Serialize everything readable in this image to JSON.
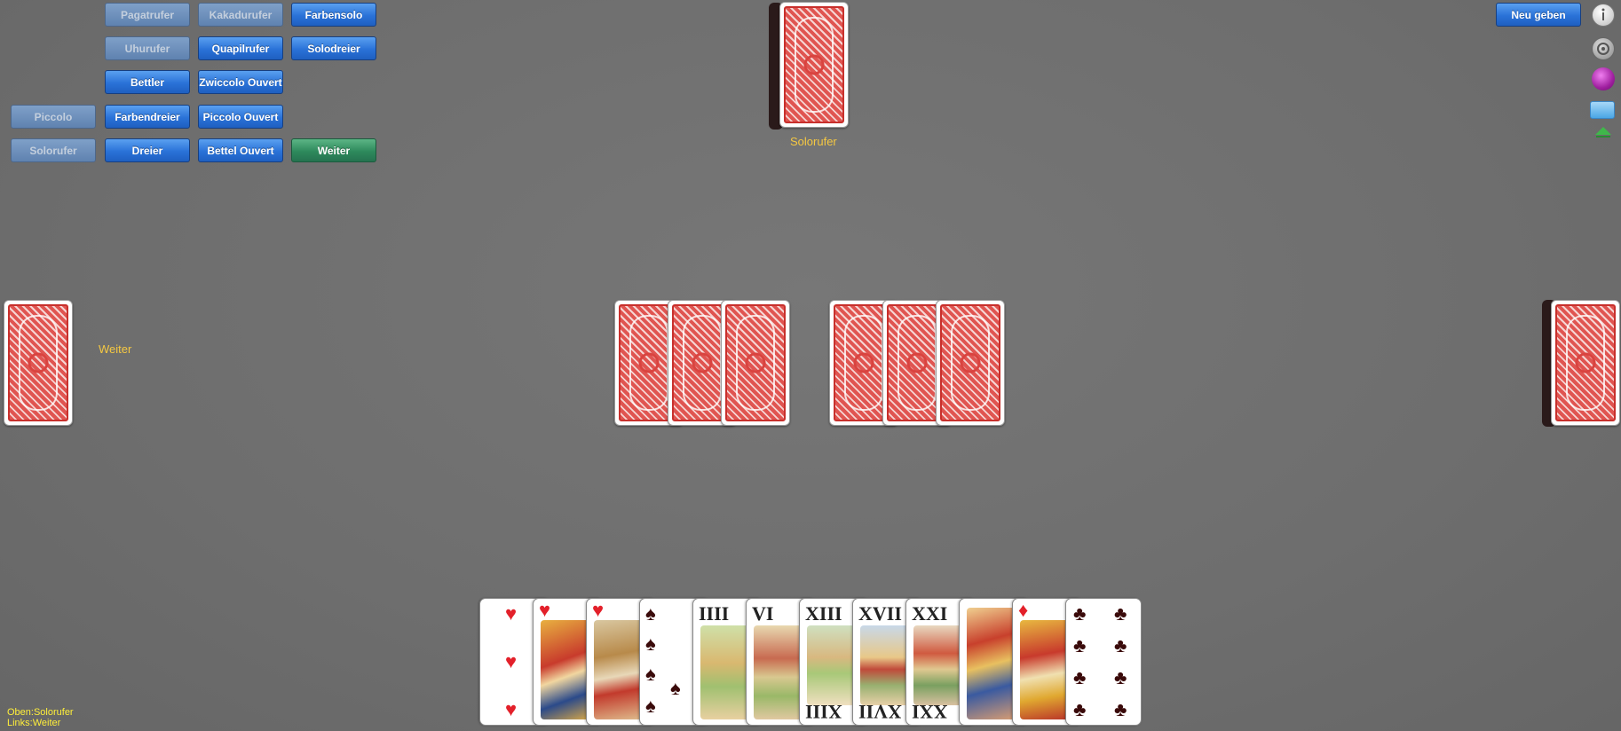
{
  "bids": {
    "pagatrufer": "Pagatrufer",
    "kakadurufer": "Kakadurufer",
    "farbensolo": "Farbensolo",
    "uhrufer": "Uhurufer",
    "quapilrufer": "Quapilrufer",
    "solodreier": "Solodreier",
    "bettler": "Bettler",
    "zwiccolo_ouvert": "Zwiccolo Ouvert",
    "piccolo": "Piccolo",
    "farbendreier": "Farbendreier",
    "piccolo_ouvert": "Piccolo Ouvert",
    "solorufer": "Solorufer",
    "dreier": "Dreier",
    "bettel_ouvert": "Bettel Ouvert",
    "weiter": "Weiter"
  },
  "new_deal_label": "Neu geben",
  "top_player_bid": "Solorufer",
  "left_player_bid": "Weiter",
  "hand": [
    {
      "type": "pip",
      "suit": "hearts",
      "rank": "pip-card"
    },
    {
      "type": "face",
      "suit": "hearts",
      "rank": "face-card"
    },
    {
      "type": "face",
      "suit": "hearts",
      "rank": "face-card"
    },
    {
      "type": "pip",
      "suit": "spades",
      "rank": "pip-card"
    },
    {
      "type": "tarock",
      "numeral": "IIII"
    },
    {
      "type": "tarock",
      "numeral": "VI"
    },
    {
      "type": "tarock",
      "numeral": "XIII"
    },
    {
      "type": "tarock",
      "numeral": "XVII"
    },
    {
      "type": "tarock",
      "numeral": "XXI"
    },
    {
      "type": "face",
      "suit": "diamonds",
      "rank": "face-card"
    },
    {
      "type": "face",
      "suit": "diamonds",
      "rank": "face-card"
    },
    {
      "type": "pip",
      "suit": "clubs",
      "rank": "pip-card"
    }
  ],
  "status": {
    "line1": "Oben:Solorufer",
    "line2": "Links:Weiter"
  },
  "icons": [
    "info-icon",
    "settings-icon",
    "globe-icon",
    "folder-icon",
    "arrow-up-icon"
  ],
  "colors": {
    "table": "#707070",
    "button_blue": "#2a72d8",
    "button_green": "#2e8a5c",
    "label_yellow": "#f5c842",
    "status_yellow": "#ffef3a"
  }
}
